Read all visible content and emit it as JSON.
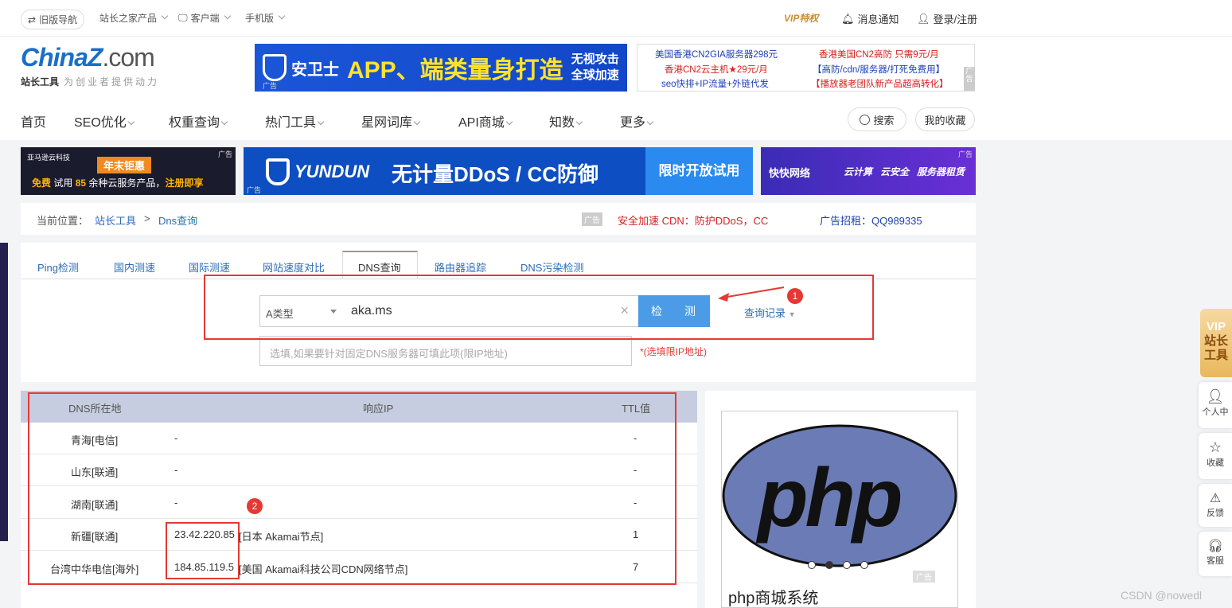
{
  "topbar": {
    "old_nav": "旧版导航",
    "products": "站长之家产品",
    "client": "客户端",
    "mobile": "手机版",
    "vip": "VIP特权",
    "notify": "消息通知",
    "login": "登录/注册"
  },
  "logo": {
    "brand": "ChinaZ",
    "brand_suffix": ".com",
    "sub": "站长工具",
    "slogan": "为创业者提供动力"
  },
  "banner_top": {
    "brand": "安卫士",
    "main": "APP、端类量身打造",
    "right1": "无视攻击",
    "right2": "全球加速",
    "tag": "广告"
  },
  "text_ads": {
    "a1": "美国香港CN2GIA服务器298元",
    "a2": "香港美国CN2高防 只需9元/月",
    "a3": "香港CN2云主机★29元/月",
    "a4": "【高防/cdn/服务器/打死免费用】",
    "a5": "seo快排+IP流量+外链代发",
    "a6": "【播放器老团队新产品超高转化】",
    "tag": "广告"
  },
  "nav": {
    "home": "首页",
    "seo": "SEO优化",
    "weight": "权重查询",
    "hot": "热门工具",
    "words": "星网词库",
    "api": "API商城",
    "zhishu": "知数",
    "more": "更多",
    "search": "搜索",
    "fav": "我的收藏"
  },
  "banner_row": {
    "b2": {
      "brand": "亚马逊云科技",
      "title": "年末钜惠",
      "line_free": "免费",
      "line_mid": "试用",
      "line_num": "85",
      "line_rest": "余种云服务产品，",
      "line_cta": "注册即享",
      "tag": "广告"
    },
    "b3": {
      "brand": "YUNDUN",
      "main": "无计量DDoS / CC防御",
      "cta": "限时开放试用",
      "tag": "广告"
    },
    "b4": {
      "brand": "快快网络",
      "i1": "云计算",
      "i2": "云安全",
      "i3": "服务器租赁",
      "tag": "广告"
    }
  },
  "breadcrumb": {
    "label": "当前位置：",
    "root": "站长工具",
    "sep": ">",
    "current": "Dns查询",
    "ad_tag": "广告",
    "ad_text": "安全加速 CDN：防护DDoS，CC",
    "recruit": "广告招租：QQ989335"
  },
  "tabs": [
    "Ping检测",
    "国内测速",
    "国际测速",
    "网站速度对比",
    "DNS查询",
    "路由器追踪",
    "DNS污染检测"
  ],
  "form": {
    "type": "A类型",
    "domain": "aka.ms",
    "submit": "检 测",
    "history": "查询记录",
    "dns_placeholder": "选填,如果要针对固定DNS服务器可填此项(限IP地址)",
    "dns_hint": "*(选填限IP地址)"
  },
  "annotations": {
    "n1": "1",
    "n2": "2"
  },
  "table": {
    "headers": [
      "DNS所在地",
      "响应IP",
      "TTL值"
    ],
    "rows": [
      {
        "loc": "青海[电信]",
        "ip": "-",
        "note": "",
        "ttl": "-"
      },
      {
        "loc": "山东[联通]",
        "ip": "-",
        "note": "",
        "ttl": "-"
      },
      {
        "loc": "湖南[联通]",
        "ip": "-",
        "note": "",
        "ttl": "-"
      },
      {
        "loc": "新疆[联通]",
        "ip": "23.42.220.85",
        "note": "[日本 Akamai节点]",
        "ttl": "1"
      },
      {
        "loc": "台湾中华电信[海外]",
        "ip": "184.85.119.5",
        "note": "[美国 Akamai科技公司CDN网络节点]",
        "ttl": "7"
      }
    ]
  },
  "side_ad": {
    "logo": "php",
    "caption": "php商城系统",
    "tag": "广告"
  },
  "right_bar": {
    "vip1": "VIP",
    "vip2": "站长",
    "vip3": "工具",
    "personal": "个人中",
    "fav": "收藏",
    "feedback": "反馈",
    "service": "客服"
  },
  "watermark": "CSDN @nowedl"
}
